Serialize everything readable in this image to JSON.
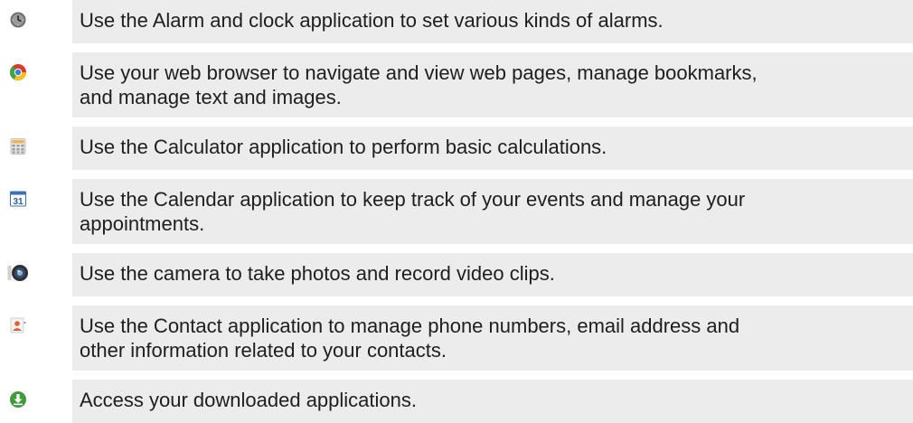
{
  "apps": [
    {
      "icon": "alarm-clock-icon",
      "description": "Use the Alarm and clock application to set various kinds of alarms."
    },
    {
      "icon": "browser-icon",
      "description": "Use your web browser to navigate and view web pages, manage bookmarks,\nand manage text and images."
    },
    {
      "icon": "calculator-icon",
      "description": "Use the Calculator application to perform basic calculations."
    },
    {
      "icon": "calendar-icon",
      "description": "Use the Calendar application to keep track of your events and manage your\nappointments."
    },
    {
      "icon": "camera-icon",
      "description": "Use the camera to take photos and record video clips."
    },
    {
      "icon": "contacts-icon",
      "description": "Use the Contact application to manage phone numbers, email address and\nother information related to your contacts."
    },
    {
      "icon": "downloads-icon",
      "description": "Access your downloaded applications."
    }
  ],
  "calendar_icon_text": "31",
  "colors": {
    "band": "#ececec",
    "text": "#1e1e1e",
    "browser_red": "#d93a2b",
    "browser_yellow": "#f2c21b",
    "browser_green": "#3aa645",
    "browser_blue": "#3d7fd6",
    "download_green": "#3e9a3a"
  }
}
